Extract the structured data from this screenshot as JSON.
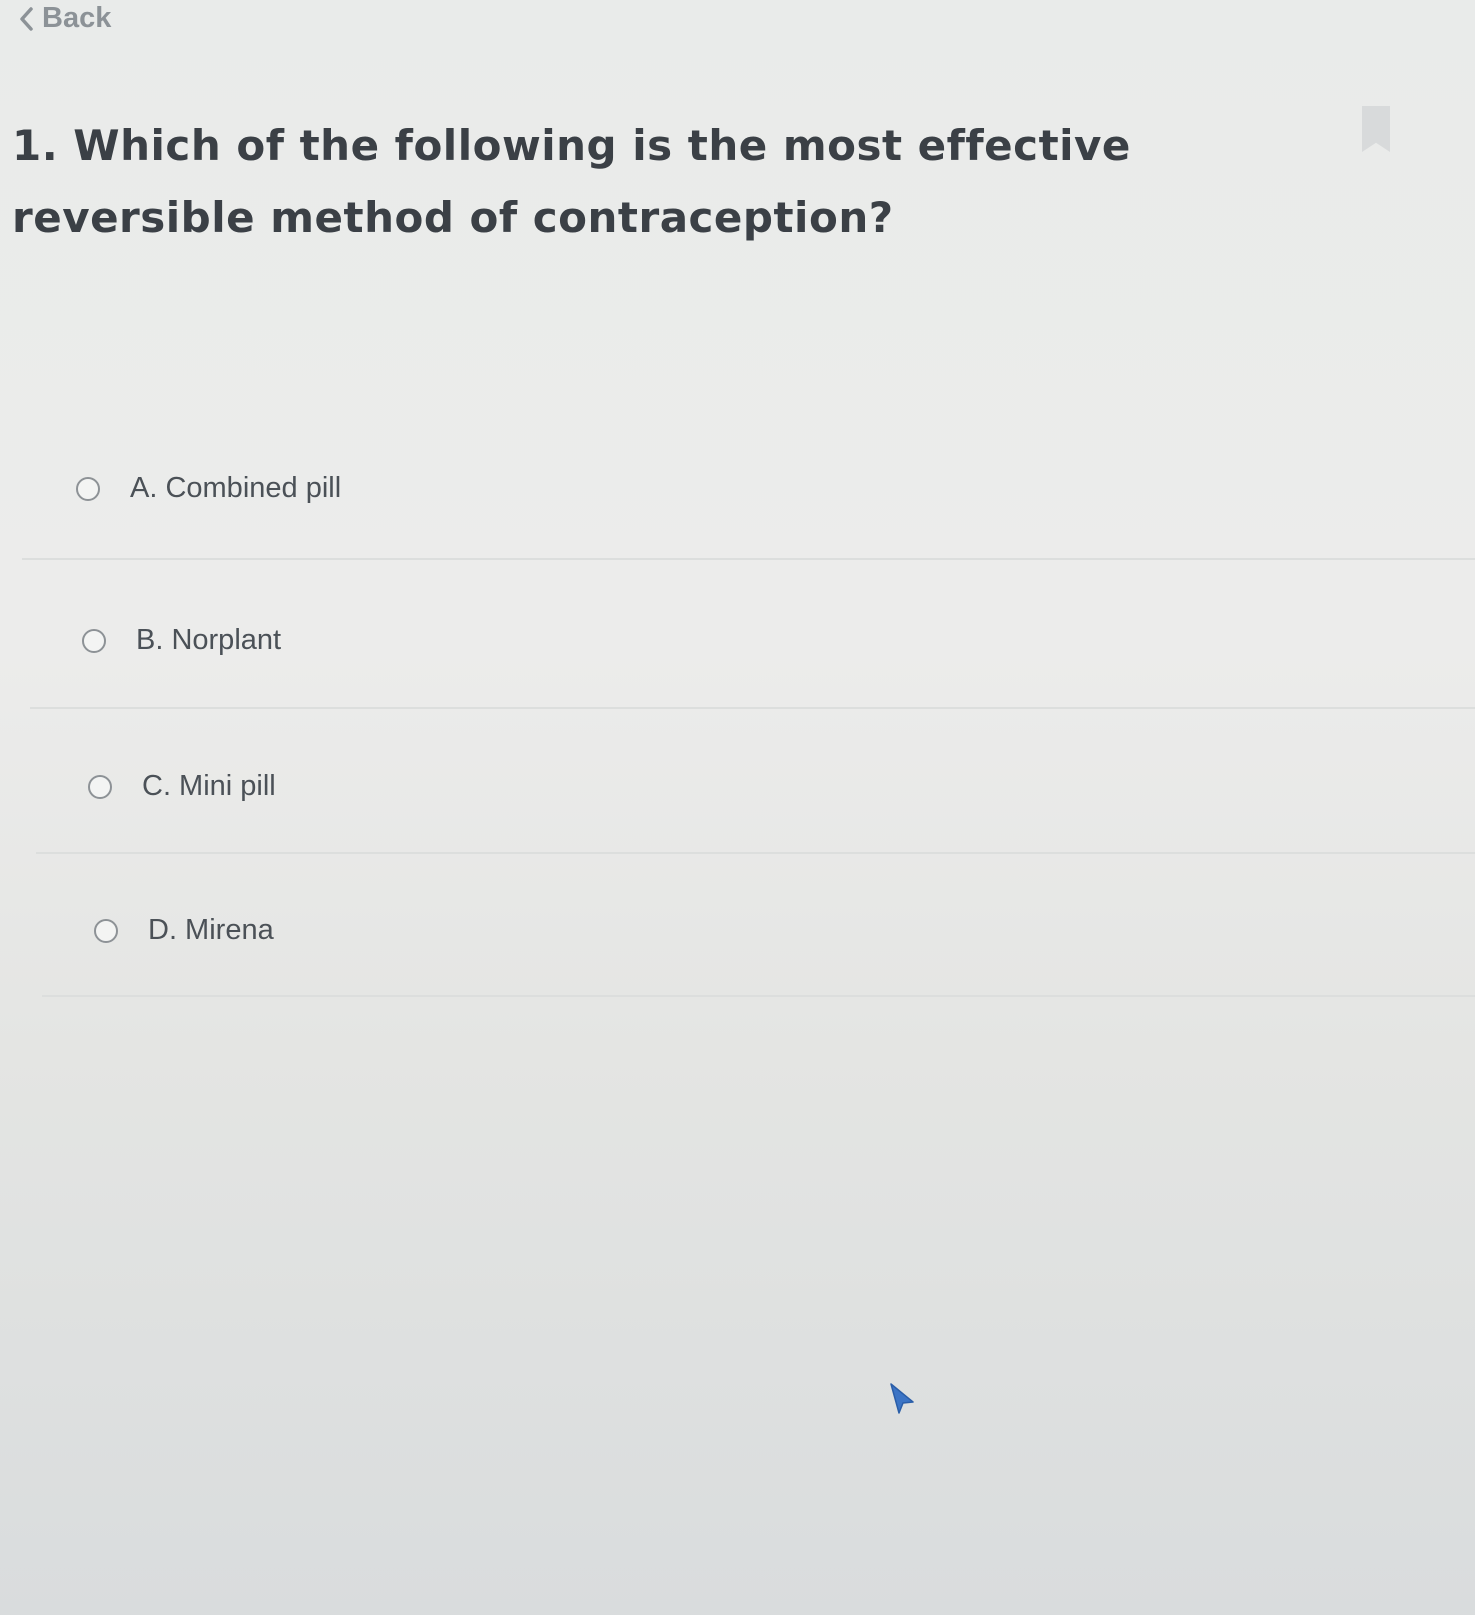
{
  "nav": {
    "back_label": "Back"
  },
  "question": {
    "text": "1. Which of the following is the most effective reversible method of contraception?"
  },
  "options": [
    {
      "label": "A. Combined pill",
      "selected": false
    },
    {
      "label": "B. Norplant",
      "selected": false
    },
    {
      "label": "C. Mini pill",
      "selected": false
    },
    {
      "label": "D. Mirena",
      "selected": false
    }
  ],
  "colors": {
    "background": "#ececeb",
    "question_text": "#3b4046",
    "option_text": "#4b5157",
    "back_link": "#8c9297",
    "cursor": "#3b74c5"
  },
  "icons": {
    "back": "chevron-left-icon",
    "bookmark": "bookmark-icon",
    "cursor": "mouse-cursor-icon"
  }
}
